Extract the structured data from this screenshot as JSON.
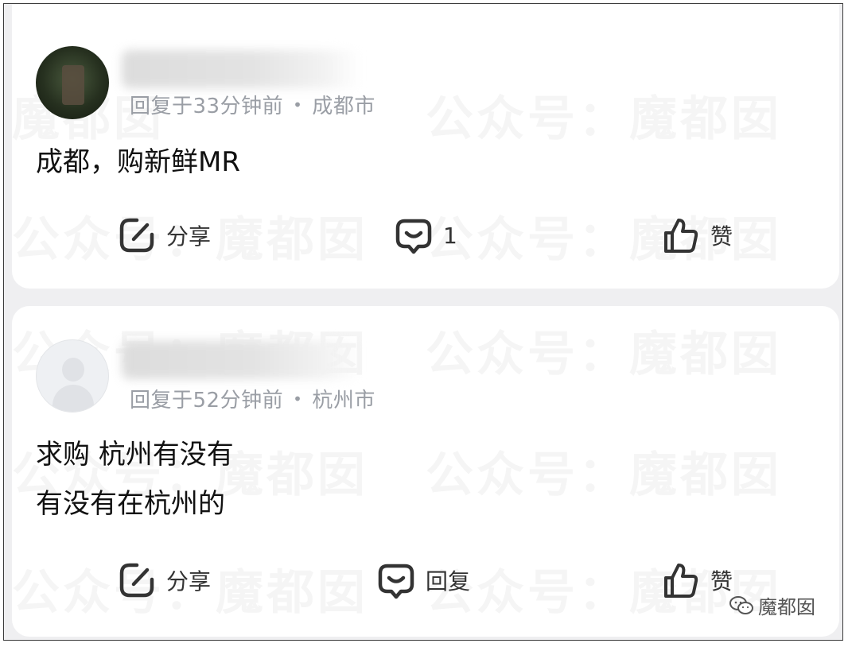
{
  "comments": [
    {
      "time": "回复于33分钟前",
      "location": "成都市",
      "text_lines": [
        "成都，购新鲜MR"
      ],
      "actions": {
        "share_label": "分享",
        "reply_label": "1",
        "like_label": "赞"
      }
    },
    {
      "time": "回复于52分钟前",
      "location": "杭州市",
      "text_lines": [
        "求购 杭州有没有",
        "有没有在杭州的"
      ],
      "actions": {
        "share_label": "分享",
        "reply_label": "回复",
        "like_label": "赞"
      }
    }
  ],
  "separator": "•",
  "watermark": {
    "text": "公众号：魔都囡",
    "fragment": "魔都囡"
  },
  "brand": {
    "label": "魔都囡",
    "icon": "wechat-icon"
  },
  "colors": {
    "meta": "#9a9ea5",
    "text": "#111111",
    "icon": "#333333"
  }
}
